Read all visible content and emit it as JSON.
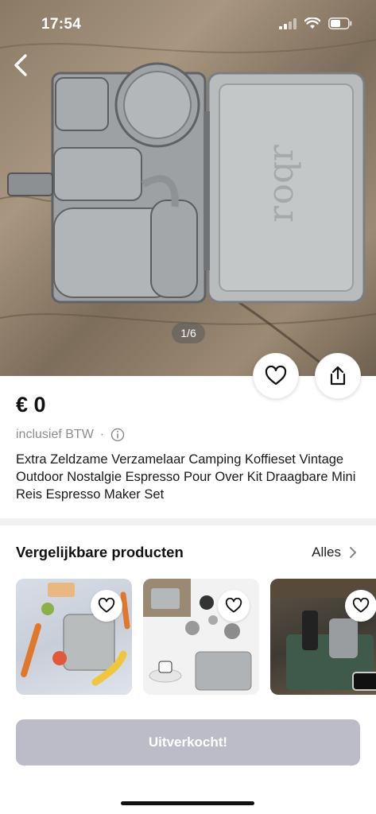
{
  "status_bar": {
    "time": "17:54"
  },
  "gallery": {
    "counter": "1/6"
  },
  "product": {
    "price": "€ 0",
    "vat_label": "inclusief BTW",
    "vat_separator": "·",
    "title": "Extra Zeldzame Verzamelaar Camping Koffieset Vintage Outdoor Nostalgie Espresso Pour Over Kit Draagbare Mini Reis Espresso Maker Set"
  },
  "similar": {
    "title": "Vergelijkbare producten",
    "all_label": "Alles",
    "items": [
      {
        "name": "product-1"
      },
      {
        "name": "product-2"
      },
      {
        "name": "product-3"
      }
    ]
  },
  "action": {
    "sold_label": "Uitverkocht!"
  },
  "colors": {
    "sold_button": "#bbbcc8",
    "divider": "#f1f1f4",
    "muted_text": "#8c8c8c"
  },
  "icons": [
    "back-icon",
    "heart-icon",
    "share-icon",
    "info-icon",
    "chevron-right-icon",
    "signal-icon",
    "wifi-icon",
    "battery-icon"
  ]
}
